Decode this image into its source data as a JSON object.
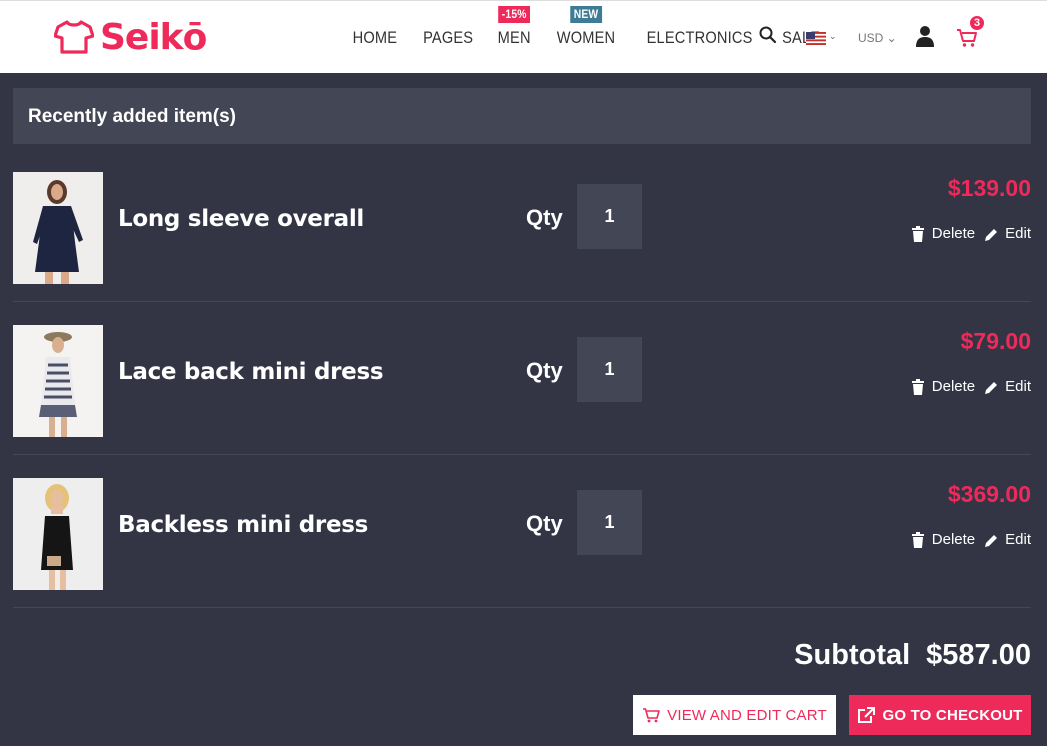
{
  "brand": {
    "name": "Seikō",
    "accent": "#ee2a5b"
  },
  "nav": {
    "items": [
      {
        "label": "HOME",
        "badge": ""
      },
      {
        "label": "PAGES",
        "badge": ""
      },
      {
        "label": "MEN",
        "badge": "-15%"
      },
      {
        "label": "WOMEN",
        "badge": "NEW"
      },
      {
        "label": "ELECTRONICS",
        "badge": ""
      },
      {
        "label": "SALE",
        "badge": ""
      }
    ]
  },
  "header": {
    "currency": "USD",
    "cart_count": "3"
  },
  "cart": {
    "title": "Recently added item(s)",
    "qty_label": "Qty",
    "delete_label": "Delete",
    "edit_label": "Edit",
    "items": [
      {
        "name": "Long sleeve overall",
        "qty": "1",
        "price": "$139.00"
      },
      {
        "name": "Lace back mini dress",
        "qty": "1",
        "price": "$79.00"
      },
      {
        "name": "Backless mini dress",
        "qty": "1",
        "price": "$369.00"
      }
    ],
    "subtotal_label": "Subtotal",
    "subtotal_value": "$587.00",
    "view_cart_label": "VIEW AND EDIT CART",
    "checkout_label": "GO TO CHECKOUT"
  }
}
